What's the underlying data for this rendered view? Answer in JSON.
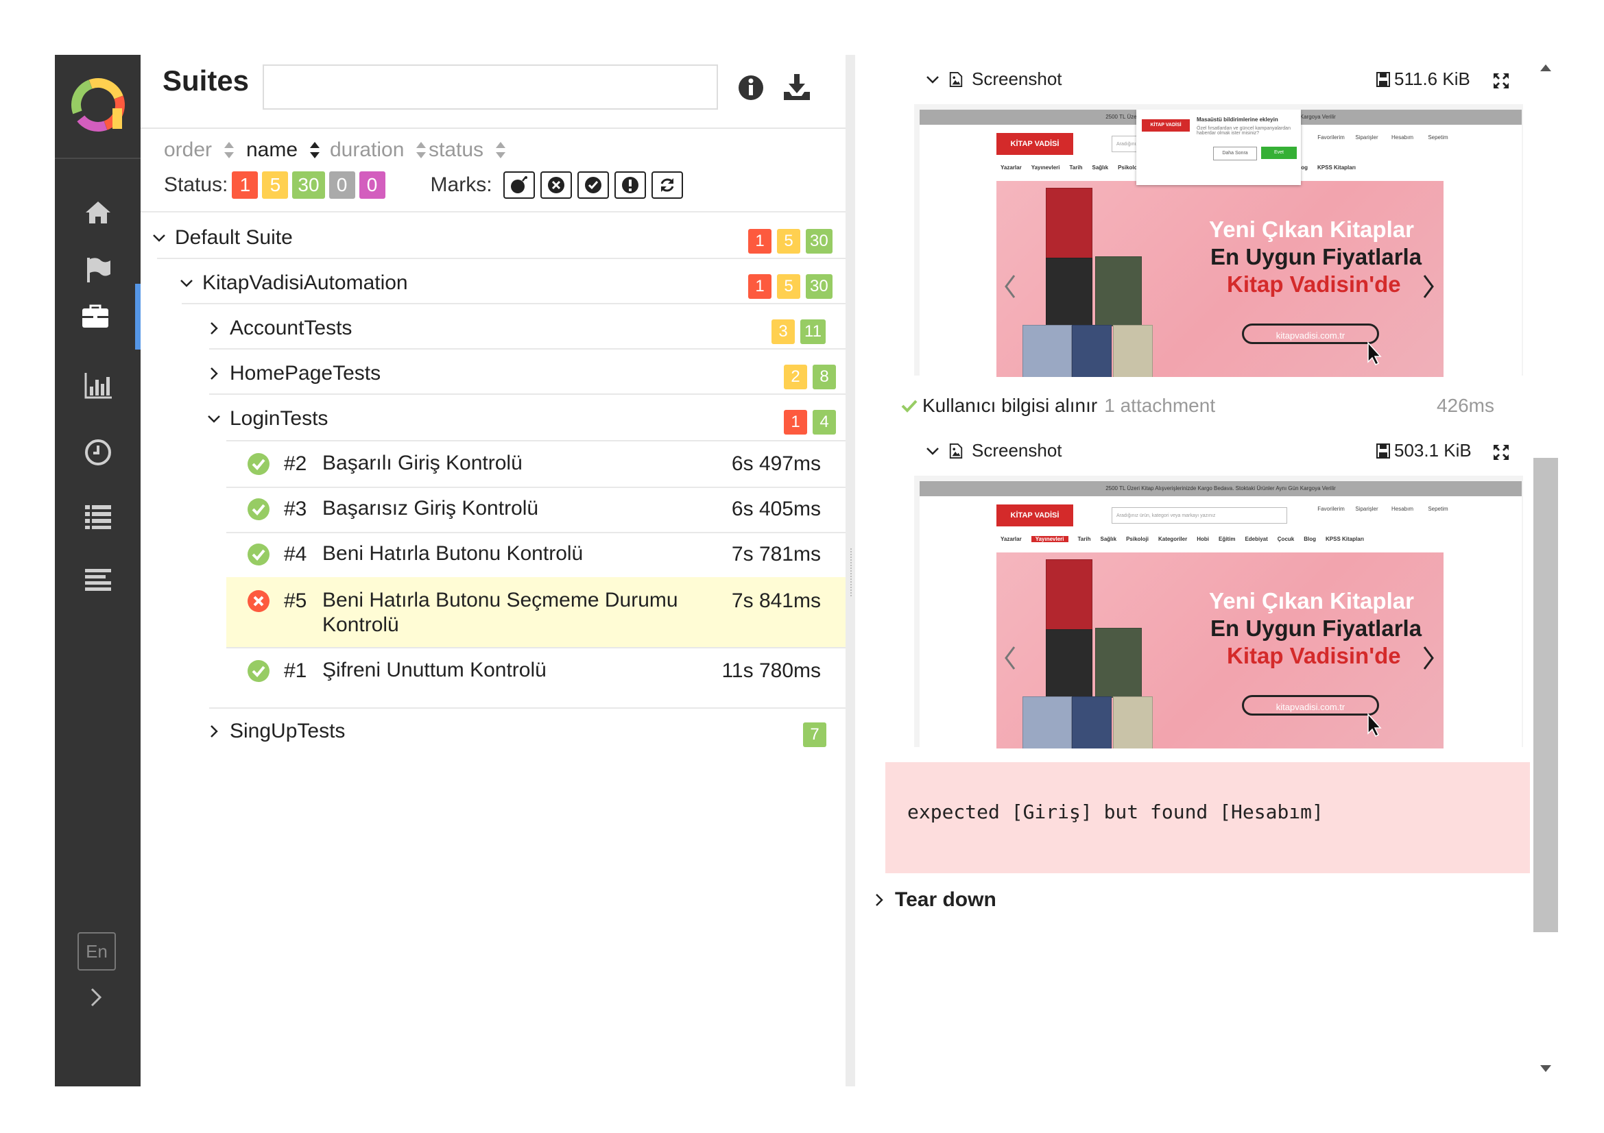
{
  "header": {
    "title": "Suites",
    "search_value": ""
  },
  "sorters": [
    {
      "label": "order"
    },
    {
      "label": "name"
    },
    {
      "label": "duration"
    },
    {
      "label": "status"
    }
  ],
  "status_filter": {
    "label": "Status:",
    "counts": {
      "failed": "1",
      "broken": "5",
      "passed": "30",
      "skipped": "0",
      "unknown": "0"
    }
  },
  "marks": {
    "label": "Marks:",
    "icons": [
      "flaky-icon",
      "new-failed-icon",
      "new-passed-icon",
      "new-broken-icon",
      "retries-icon"
    ]
  },
  "tree": {
    "default_suite": {
      "name": "Default Suite",
      "failed": "1",
      "broken": "5",
      "passed": "30"
    },
    "project": {
      "name": "KitapVadisiAutomation",
      "failed": "1",
      "broken": "5",
      "passed": "30"
    },
    "account_tests": {
      "name": "AccountTests",
      "broken": "3",
      "passed": "11"
    },
    "home_page_tests": {
      "name": "HomePageTests",
      "broken": "2",
      "passed": "8"
    },
    "login_tests": {
      "name": "LoginTests",
      "failed": "1",
      "passed": "4"
    },
    "tests": [
      {
        "num": "#2",
        "name": "Başarılı Giriş Kontrolü",
        "duration": "6s 497ms",
        "status": "passed"
      },
      {
        "num": "#3",
        "name": "Başarısız Giriş Kontrolü",
        "duration": "6s 405ms",
        "status": "passed"
      },
      {
        "num": "#4",
        "name": "Beni Hatırla Butonu Kontrolü",
        "duration": "7s 781ms",
        "status": "passed"
      },
      {
        "num": "#5",
        "name": "Beni Hatırla Butonu Seçmeme Durumu Kontrolü",
        "duration": "7s 841ms",
        "status": "failed"
      },
      {
        "num": "#1",
        "name": "Şifreni Unuttum Kontrolü",
        "duration": "11s 780ms",
        "status": "passed"
      }
    ],
    "sign_up_tests": {
      "name": "SingUpTests",
      "passed": "7"
    }
  },
  "sidebar": {
    "items": [
      "home-icon",
      "flag-icon",
      "briefcase-icon",
      "bar-chart-icon",
      "clock-icon",
      "list-icon",
      "lines-icon"
    ],
    "language": "En"
  },
  "details": {
    "attachment1": {
      "label": "Screenshot",
      "size": "511.6 KiB"
    },
    "step": {
      "name": "Kullanıcı bilgisi alınır",
      "attachments": "1 attachment",
      "duration": "426ms"
    },
    "attachment2": {
      "label": "Screenshot",
      "size": "503.1 KiB"
    },
    "error": "expected [Giriş] but found [Hesabım]",
    "teardown": "Tear down"
  },
  "screenshot": {
    "topbar": "2500 TL Üzeri Kitap Alışverişlerinizde Kargo Bedava. Stoktaki Ürünler Aynı Gün Kargoya Verilir",
    "logo": "KİTAP VADİSİ",
    "search_placeholder": "Aradığınız ürün, kategori veya markayı yazınız",
    "icons": [
      "Favorilerim",
      "Siparişler",
      "Hesabım",
      "Sepetim"
    ],
    "menu": [
      "Yazarlar",
      "Yayınevleri",
      "Tarih",
      "Sağlık",
      "Psikoloji",
      "Kategoriler",
      "Hobi",
      "Eğitim",
      "Edebiyat",
      "Çocuk",
      "Blog",
      "KPSS Kitapları"
    ],
    "banner_line1": "Yeni Çıkan Kitaplar",
    "banner_line2": "En Uygun Fiyatlarla",
    "banner_line3": "Kitap Vadisin'de",
    "banner_url": "kitapvadisi.com.tr",
    "popup_title": "Masaüstü bildirimlerine ekleyin",
    "popup_text": "Özel fırsatlardan ve güncel kampanyalardan haberdar olmak ister misiniz?",
    "popup_later": "Daha Sonra",
    "popup_yes": "Evet"
  },
  "colors": {
    "failed": "#fd5a3e",
    "broken": "#ffd050",
    "passed": "#97cc64",
    "skipped": "#aaaaaa",
    "unknown": "#d35ebe",
    "sidebar": "#343434",
    "active_accent": "#5596e6"
  }
}
